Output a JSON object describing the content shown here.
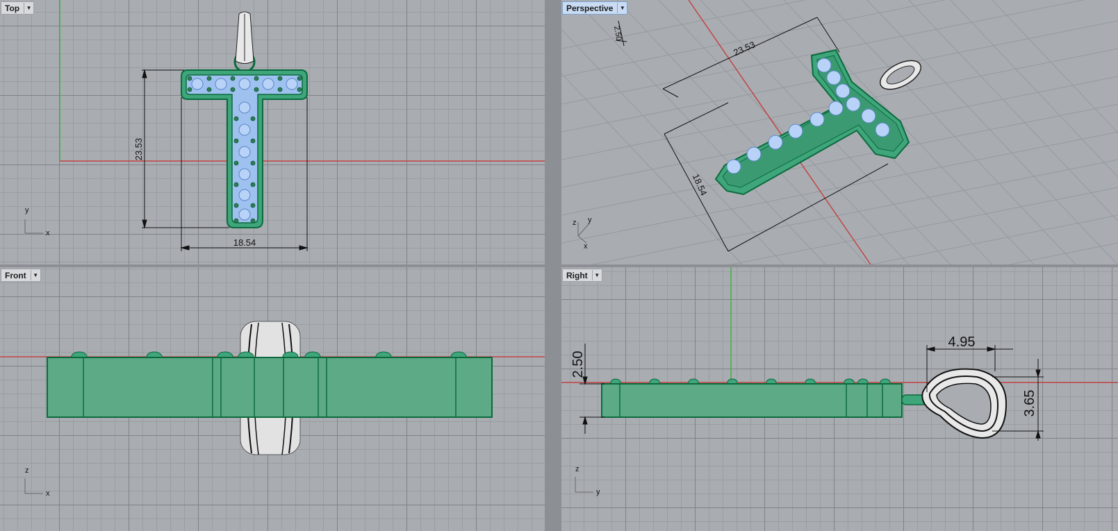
{
  "viewports": {
    "top": {
      "label": "Top"
    },
    "perspective": {
      "label": "Perspective"
    },
    "front": {
      "label": "Front"
    },
    "right": {
      "label": "Right"
    }
  },
  "menu_icon": "dropdown-arrow",
  "dimensions": {
    "top": {
      "height": "23.53",
      "width": "18.54"
    },
    "perspective": {
      "thickness": "2.50",
      "length": "23.53",
      "width": "18.54"
    },
    "right": {
      "thickness": "2.50",
      "bail_width": "4.95",
      "bail_height": "3.65"
    }
  },
  "axes": {
    "x": "x",
    "y": "y",
    "z": "z"
  },
  "colors": {
    "body": "#3fa57b",
    "body_edge": "#0b6a3d",
    "gem": "#9fc1f0",
    "grid_major": "#7f8287",
    "grid_minor": "#9a9ea3",
    "x_axis": "#c24444",
    "y_axis": "#44b044",
    "active_label": "#c9dcf3"
  }
}
